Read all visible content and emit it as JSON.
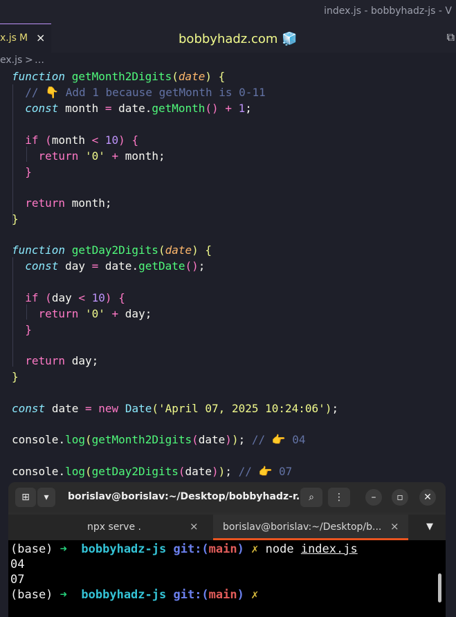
{
  "window": {
    "title": "index.js - bobbyhadz-js - V",
    "site_title": "bobbyhadz.com 🧊"
  },
  "editor_tab": {
    "label": "x.js",
    "badge": "M",
    "close": "×"
  },
  "breadcrumb": {
    "file": "ex.js",
    "sep": ">",
    "rest": "…"
  },
  "code": {
    "fn1_kw": "function",
    "fn1_name": "getMonth2Digits",
    "fn1_param": "date",
    "l2_comment": "// 👇 Add 1 because getMonth is 0-11",
    "l3_const": "const",
    "l3_var": "month",
    "l3_obj": "date",
    "l3_method": "getMonth",
    "l3_num": "1",
    "l5_if": "if",
    "l5_var": "month",
    "l5_num": "10",
    "l6_return": "return",
    "l6_str": "'0'",
    "l6_var": "month",
    "l9_return": "return",
    "l9_var": "month",
    "fn2_kw": "function",
    "fn2_name": "getDay2Digits",
    "fn2_param": "date",
    "l13_const": "const",
    "l13_var": "day",
    "l13_obj": "date",
    "l13_method": "getDate",
    "l15_if": "if",
    "l15_var": "day",
    "l15_num": "10",
    "l16_return": "return",
    "l16_str": "'0'",
    "l16_var": "day",
    "l19_return": "return",
    "l19_var": "day",
    "l22_const": "const",
    "l22_var": "date",
    "l22_new": "new",
    "l22_cls": "Date",
    "l22_str": "'April 07, 2025 10:24:06'",
    "l24_console": "console",
    "l24_log": "log",
    "l24_fn": "getMonth2Digits",
    "l24_arg": "date",
    "l24_comment": "// 👉 04",
    "l26_console": "console",
    "l26_log": "log",
    "l26_fn": "getDay2Digits",
    "l26_arg": "date",
    "l26_comment": "// 👉 07"
  },
  "terminal": {
    "title": "borislav@borislav:~/Desktop/bobbyhadz-r...",
    "tabs": [
      {
        "label": "npx serve .",
        "close": "×"
      },
      {
        "label": "borislav@borislav:~/Desktop/b...",
        "close": "×"
      }
    ],
    "prompt_base": "(base)",
    "prompt_arrow": "➜",
    "prompt_dir": "bobbyhadz-js",
    "prompt_git": "git:(",
    "prompt_branch": "main",
    "prompt_git_close": ")",
    "prompt_dirty": "✗",
    "command": "node",
    "command_arg": "index.js",
    "output": [
      "04",
      "07"
    ]
  },
  "colors": {
    "editor_bg": "#1e1f29",
    "terminal_bg": "#000000",
    "accent_tab": "#e95420"
  }
}
